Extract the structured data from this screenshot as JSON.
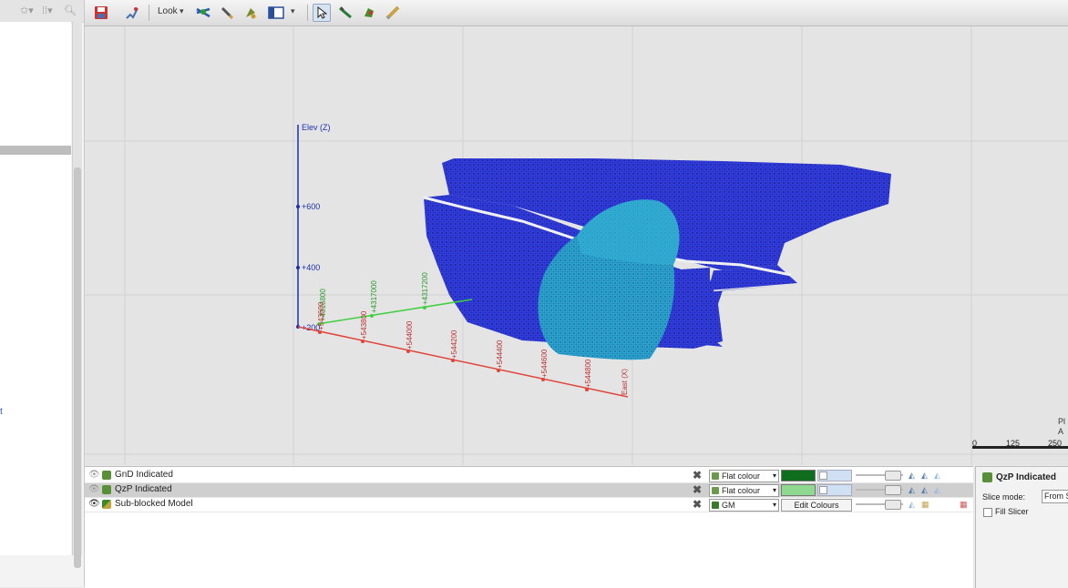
{
  "toolbar": {
    "look_label": "Look"
  },
  "viewport": {
    "axes": {
      "elev_title": "Elev (Z)",
      "elev_ticks": [
        "+200",
        "+400",
        "+600"
      ],
      "east_title": "East (X)",
      "east_ticks": [
        "+543600",
        "+543800",
        "+544000",
        "+544200",
        "+544400",
        "+544600",
        "+544800"
      ],
      "north_ticks": [
        "+4316800",
        "+4317000",
        "+4317200"
      ]
    },
    "colors": {
      "ore_body": "#2a32cc",
      "inner_body": "#2a9bc6",
      "elev_axis": "#1d2fb0",
      "east_axis": "#e0443a",
      "north_axis": "#3fcf3f"
    }
  },
  "scale_bar": {
    "labels": [
      "0",
      "125",
      "250"
    ],
    "side_text": [
      "Pl",
      "A"
    ]
  },
  "shapes": [
    {
      "name": "GnD Indicated",
      "mode": "Flat colour",
      "colour": "#0e6e1e",
      "selected": false
    },
    {
      "name": "QzP Indicated",
      "mode": "Flat colour",
      "colour": "#8fd88f",
      "selected": true
    },
    {
      "name": "Sub-blocked Model",
      "mode": "GM",
      "button": "Edit Colours",
      "selected": false
    }
  ],
  "properties": {
    "title": "QzP Indicated",
    "slice_mode_label": "Slice mode:",
    "slice_mode_value": "From S",
    "fill_slicer_label": "Fill Slicer",
    "fill_slicer_checked": false
  }
}
